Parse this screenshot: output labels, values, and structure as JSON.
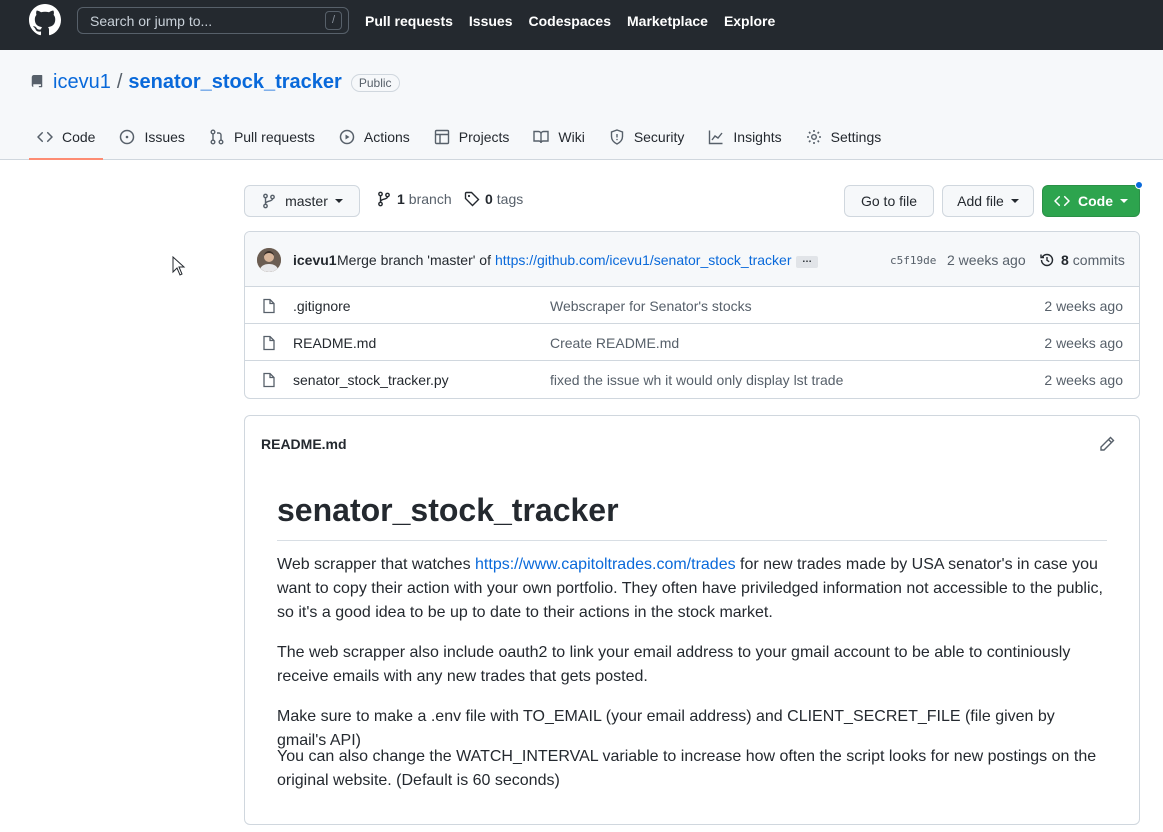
{
  "header": {
    "search_placeholder": "Search or jump to...",
    "slash": "/",
    "nav": [
      "Pull requests",
      "Issues",
      "Codespaces",
      "Marketplace",
      "Explore"
    ]
  },
  "repo": {
    "owner": "icevu1",
    "separator": "/",
    "name": "senator_stock_tracker",
    "visibility": "Public",
    "tabs": [
      {
        "label": "Code",
        "icon": "code-icon",
        "active": true
      },
      {
        "label": "Issues",
        "icon": "issue-icon"
      },
      {
        "label": "Pull requests",
        "icon": "pull-request-icon"
      },
      {
        "label": "Actions",
        "icon": "play-icon"
      },
      {
        "label": "Projects",
        "icon": "table-icon"
      },
      {
        "label": "Wiki",
        "icon": "book-icon"
      },
      {
        "label": "Security",
        "icon": "shield-icon"
      },
      {
        "label": "Insights",
        "icon": "graph-icon"
      },
      {
        "label": "Settings",
        "icon": "gear-icon"
      }
    ]
  },
  "toolbar": {
    "branch": "master",
    "branch_count": "1",
    "branch_label": "branch",
    "tag_count": "0",
    "tag_label": "tags",
    "go_to_file": "Go to file",
    "add_file": "Add file",
    "code": "Code"
  },
  "commit": {
    "author": "icevu1",
    "message": "Merge branch 'master' of",
    "link": "https://github.com/icevu1/senator_stock_tracker",
    "ellipsis": "…",
    "sha": "c5f19de",
    "time": "2 weeks ago",
    "count": "8",
    "count_label": "commits"
  },
  "files": [
    {
      "name": ".gitignore",
      "message": "Webscraper for Senator's stocks",
      "time": "2 weeks ago"
    },
    {
      "name": "README.md",
      "message": "Create README.md",
      "time": "2 weeks ago"
    },
    {
      "name": "senator_stock_tracker.py",
      "message": "fixed the issue wh it would only display lst trade",
      "time": "2 weeks ago"
    }
  ],
  "readme": {
    "filename": "README.md",
    "title": "senator_stock_tracker",
    "p1_before": "Web scrapper that watches ",
    "p1_link": "https://www.capitoltrades.com/trades",
    "p1_after": " for new trades made by USA senator's in case you want to copy their action with your own portfolio. They often have priviledged information not accessible to the public, so it's a good idea to be up to date to their actions in the stock market.",
    "p2": "The web scrapper also include oauth2 to link your email address to your gmail account to be able to continiously receive emails with any new trades that gets posted.",
    "p3": "Make sure to make a .env file with TO_EMAIL (your email address) and CLIENT_SECRET_FILE (file given by gmail's API)",
    "p4": "You can also change the WATCH_INTERVAL variable to increase how often the script looks for new postings on the original website. (Default is 60 seconds)"
  },
  "colors": {
    "header_bg": "#24292f",
    "link": "#0969da",
    "green_button": "#2da44e",
    "active_tab_underline": "#fd8c73"
  }
}
